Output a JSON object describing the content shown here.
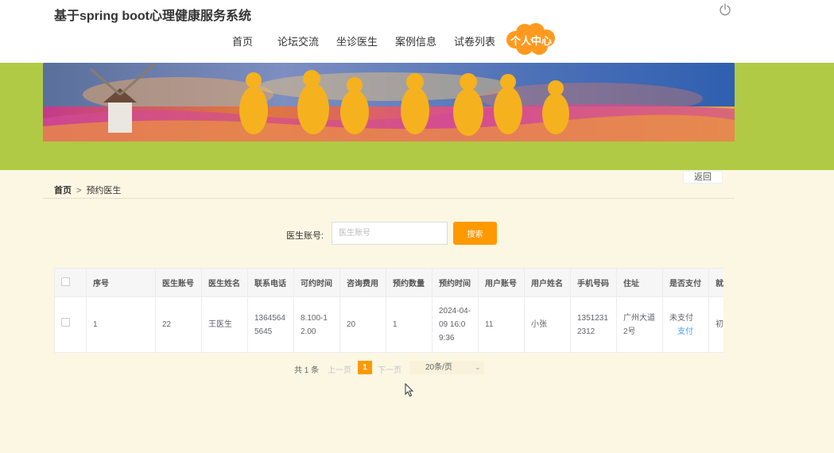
{
  "header": {
    "title": "基于spring boot心理健康服务系统",
    "nav": [
      "首页",
      "论坛交流",
      "坐诊医生",
      "案例信息",
      "试卷列表"
    ],
    "nav_active": "个人中心"
  },
  "back_label": "返回",
  "breadcrumb": {
    "home": "首页",
    "separator": ">",
    "current": "预约医生"
  },
  "search": {
    "label": "医生账号:",
    "placeholder": "医生账号",
    "value": "",
    "button": "搜索"
  },
  "table": {
    "columns": [
      "序号",
      "医生账号",
      "医生姓名",
      "联系电话",
      "可约时间",
      "咨询费用",
      "预约数量",
      "预约时间",
      "用户账号",
      "用户姓名",
      "手机号码",
      "住址",
      "是否支付",
      "就"
    ],
    "rows": [
      {
        "index": "1",
        "doctor_account": "22",
        "doctor_name": "王医生",
        "phone": "13645645645",
        "available_time": "8.100-12.00",
        "fee": "20",
        "quantity": "1",
        "appointment_time": "2024-04-09 16:09:36",
        "user_account": "11",
        "user_name": "小张",
        "mobile": "13512312312",
        "address": "广州大道2号",
        "paid_status": "未支付",
        "pay_action": "支付",
        "extra": "初"
      }
    ]
  },
  "pagination": {
    "total": "共 1 条",
    "prev": "上一页",
    "current": "1",
    "next": "下一页",
    "page_size": "20条/页"
  },
  "colors": {
    "accent": "#ff9900",
    "band": "#b1ca45",
    "background": "#fbf7e3",
    "link": "#409eff"
  }
}
